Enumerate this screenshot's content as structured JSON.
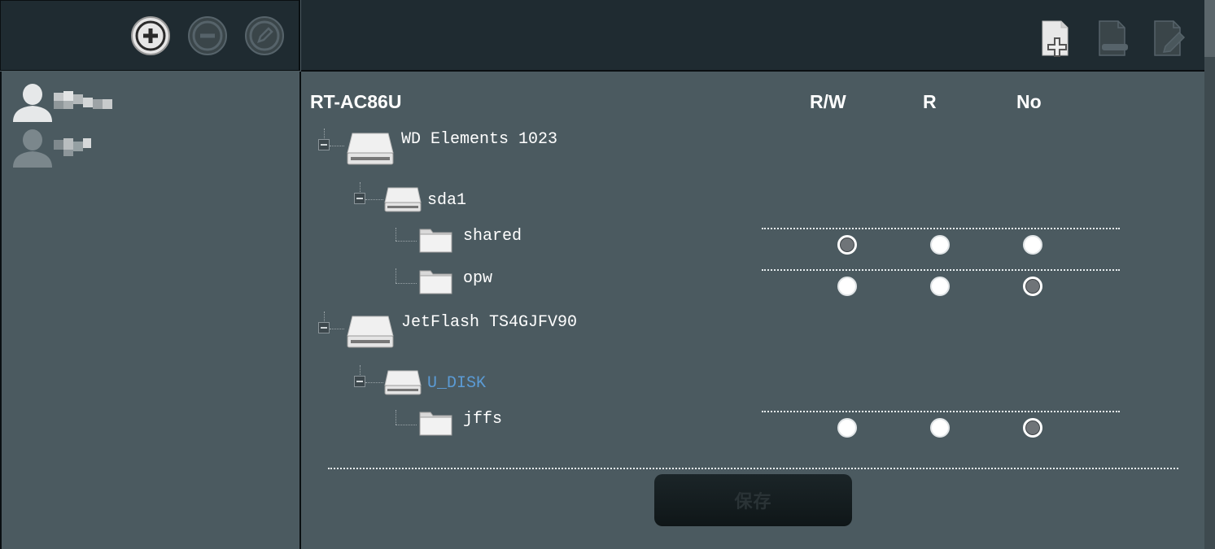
{
  "toolbar_left": {
    "icons": [
      "add-account-icon",
      "delete-account-icon",
      "edit-account-icon"
    ]
  },
  "toolbar_right": {
    "icons": [
      "add-folder-icon",
      "delete-folder-icon",
      "rename-folder-icon"
    ]
  },
  "users": [
    {
      "icon": "user-icon",
      "name": "pixelated",
      "selected": true
    },
    {
      "icon": "user-icon",
      "name": "pixelated",
      "selected": false
    }
  ],
  "device": "RT-AC86U",
  "columns": {
    "rw": "R/W",
    "r": "R",
    "no": "No"
  },
  "tree": {
    "disk1": {
      "label": "WD Elements 1023",
      "icon": "hard-drive-icon"
    },
    "disk1_part": {
      "label": "sda1",
      "icon": "partition-icon"
    },
    "disk1_folders": [
      {
        "label": "shared",
        "icon": "folder-icon",
        "permission": "R/W"
      },
      {
        "label": "opw",
        "icon": "folder-icon",
        "permission": "No"
      }
    ],
    "disk2": {
      "label": "JetFlash TS4GJFV90",
      "icon": "hard-drive-icon"
    },
    "disk2_part": {
      "label": "U_DISK",
      "icon": "partition-icon"
    },
    "disk2_folders": [
      {
        "label": "jffs",
        "icon": "folder-icon",
        "permission": "No"
      }
    ]
  },
  "save_button": "保存",
  "colors": {
    "header_bg": "#1f2b31",
    "panel_bg": "#4b5a60",
    "link": "#5b9bd5"
  }
}
